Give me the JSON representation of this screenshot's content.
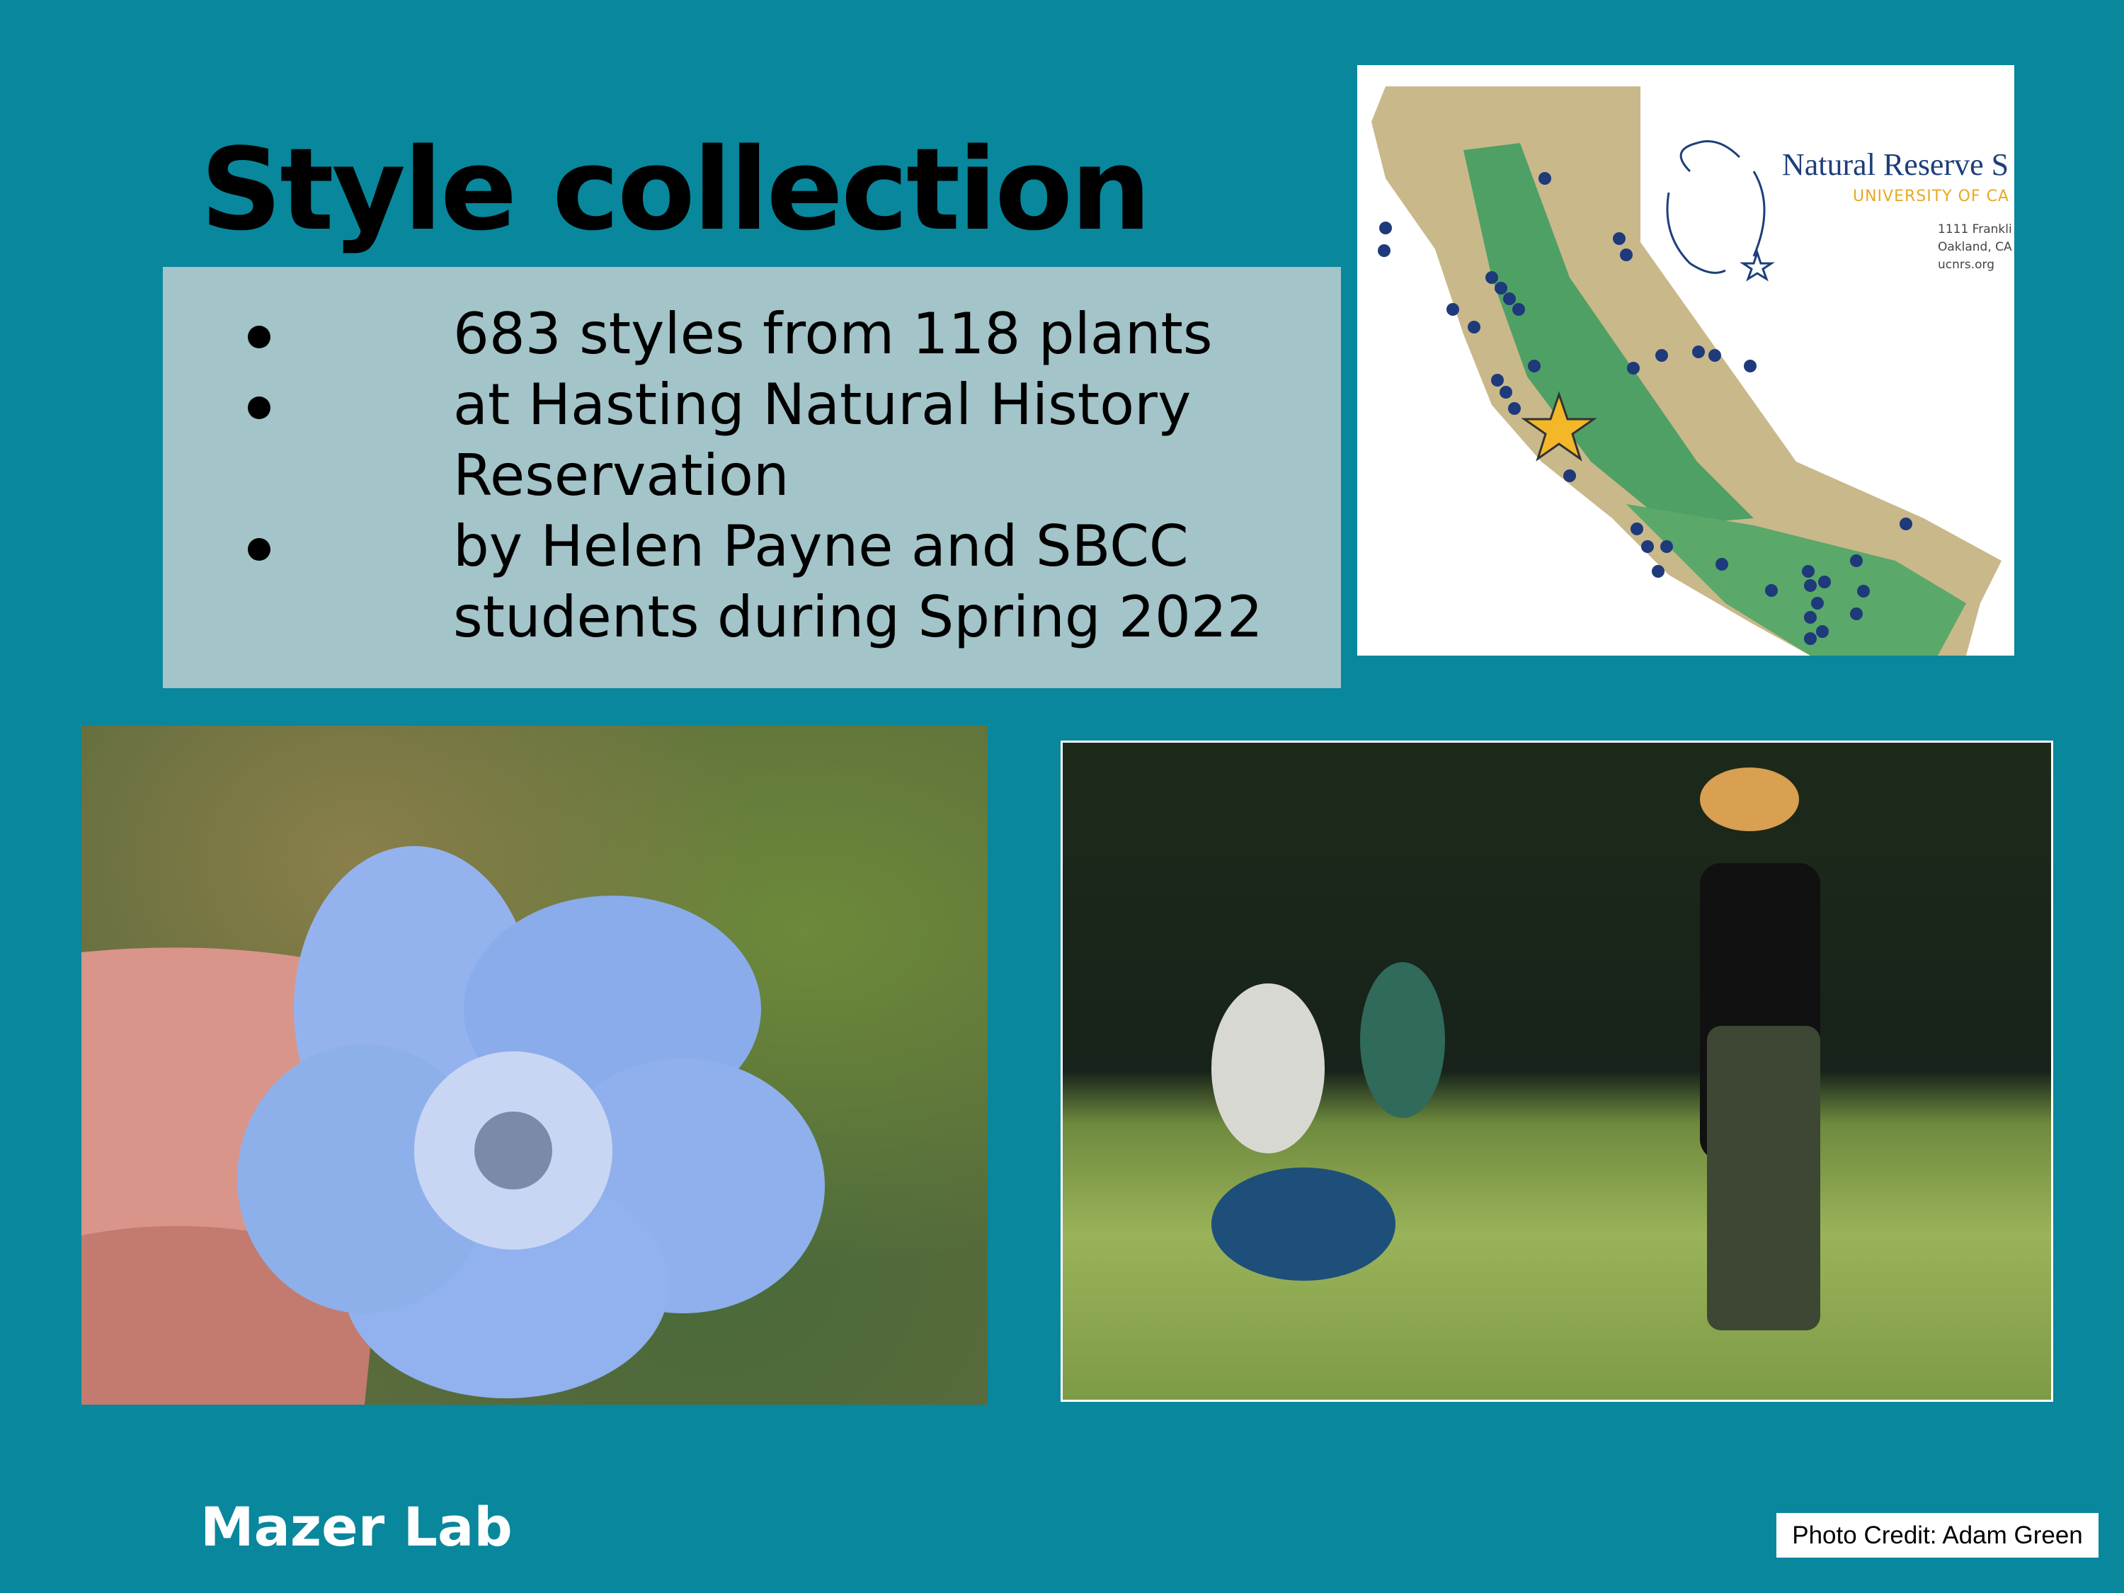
{
  "slide": {
    "title": "Style collection",
    "bullets": [
      "683 styles from 118 plants",
      "at Hasting Natural History Reservation",
      "by Helen Payne and SBCC students during Spring 2022"
    ],
    "footer": "Mazer Lab",
    "photo_credit": "Photo Credit: Adam Green"
  },
  "map": {
    "org_name": "Natural Reserve S",
    "org_subtitle": "UNIVERSITY OF CA",
    "address_lines": [
      "1111 Frankli",
      "Oakland, CA",
      "ucnrs.org"
    ],
    "marker": "star-icon"
  },
  "colors": {
    "background": "#09879c",
    "bullet_box": "#a3c4c8",
    "star": "#f4b728",
    "reserve_dots": "#1e3a7a"
  }
}
